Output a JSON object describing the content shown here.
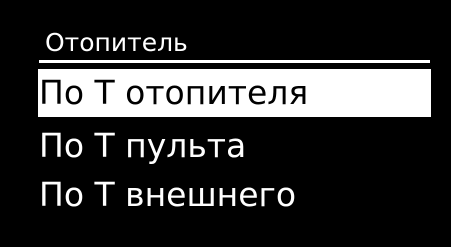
{
  "menu": {
    "title": "Отопитель",
    "items": [
      {
        "label": "По Т отопителя",
        "selected": true
      },
      {
        "label": "По Т пульта",
        "selected": false
      },
      {
        "label": "По Т внешнего",
        "selected": false
      }
    ]
  },
  "colors": {
    "background": "#000000",
    "foreground": "#ffffff",
    "highlight_background": "#ffffff",
    "highlight_text": "#000000"
  }
}
